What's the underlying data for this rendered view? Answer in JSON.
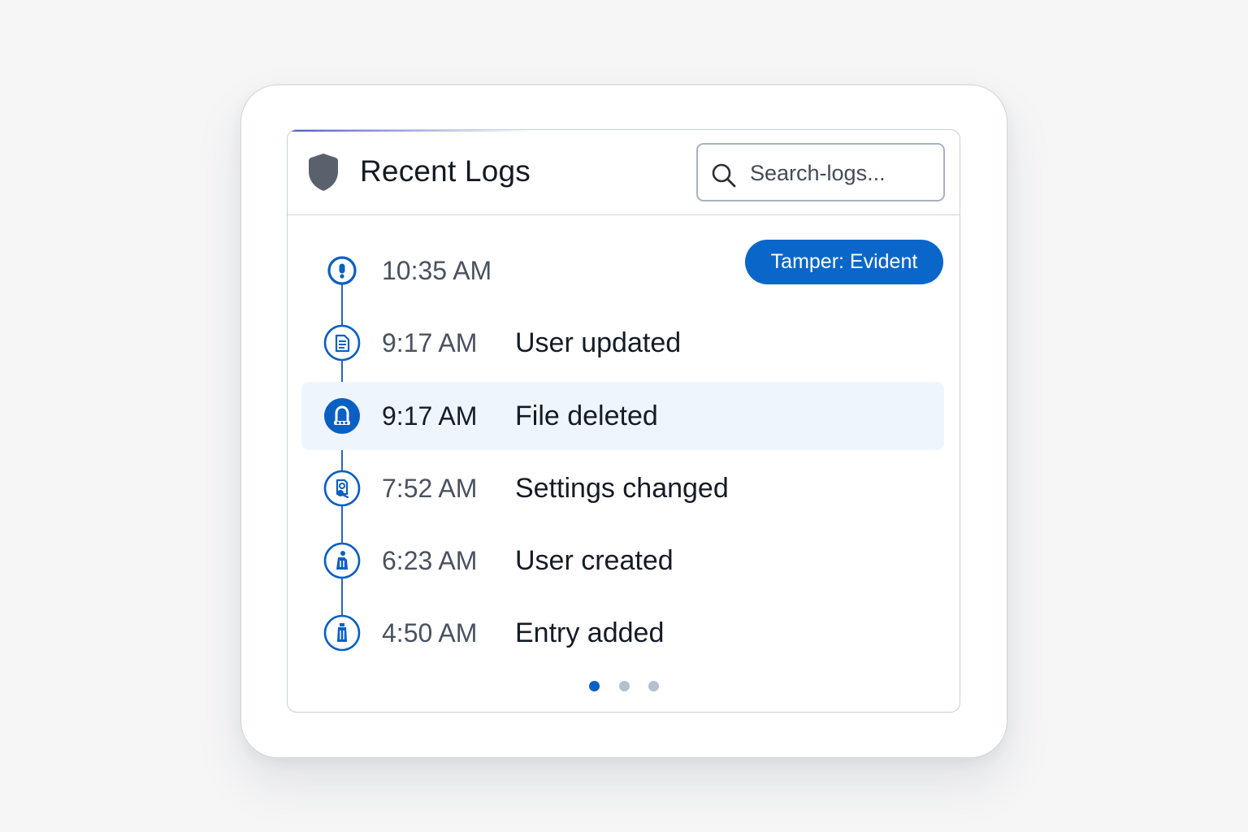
{
  "header": {
    "title": "Recent Logs",
    "icon": "shield-icon"
  },
  "search": {
    "placeholder": "Search-logs...",
    "icon": "search-icon"
  },
  "badge": {
    "label": "Tamper: Evident",
    "color": "#0a67c9"
  },
  "logs": [
    {
      "time": "10:35 AM",
      "event": "",
      "icon": "alert-icon",
      "selected": false
    },
    {
      "time": "9:17 AM",
      "event": "User updated",
      "icon": "document-icon",
      "selected": false
    },
    {
      "time": "9:17 AM",
      "event": "File deleted",
      "icon": "lock-icon",
      "selected": true
    },
    {
      "time": "7:52 AM",
      "event": "Settings changed",
      "icon": "settings-document-icon",
      "selected": false
    },
    {
      "time": "6:23 AM",
      "event": "User created",
      "icon": "user-building-icon",
      "selected": false
    },
    {
      "time": "4:50 AM",
      "event": "Entry added",
      "icon": "entry-building-icon",
      "selected": false
    }
  ],
  "pagination": {
    "pages": 3,
    "current": 1
  },
  "colors": {
    "accent": "#0a67c9",
    "timeline": "#2a62bf",
    "selected_row": "#eef5fd",
    "shield": "#59626c"
  }
}
